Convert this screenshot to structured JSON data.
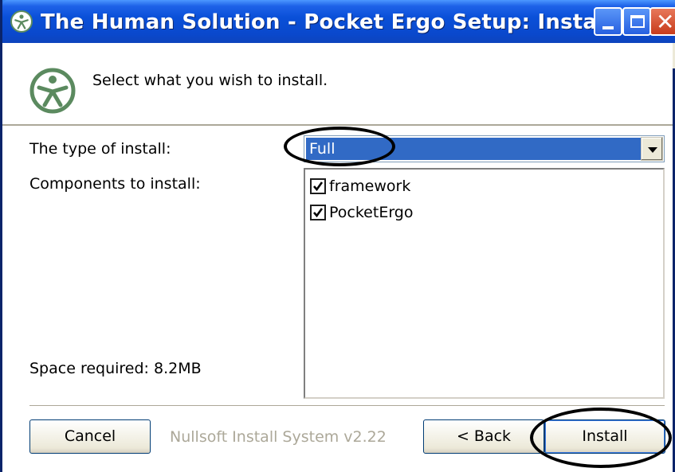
{
  "window": {
    "title": "The Human Solution - Pocket Ergo Setup: Installati...",
    "controls": {
      "minimize_icon": "minimize-icon",
      "maximize_icon": "maximize-icon",
      "close_glyph": "✕"
    }
  },
  "header": {
    "instruction": "Select what you wish to install."
  },
  "form": {
    "install_type_label": "The type of install:",
    "install_type_value": "Full",
    "components_label": "Components to install:",
    "components": [
      {
        "label": "framework",
        "checked": true
      },
      {
        "label": "PocketErgo",
        "checked": true
      }
    ],
    "space_required": "Space required: 8.2MB"
  },
  "footer": {
    "brand": "Nullsoft Install System v2.22",
    "cancel_label": "Cancel",
    "back_label": "< Back",
    "install_label": "Install"
  },
  "colors": {
    "titlebar_blue": "#0a4bd4",
    "selection_blue": "#316ac5",
    "window_face": "#ece9d8",
    "logo_green": "#5b8a5f"
  }
}
